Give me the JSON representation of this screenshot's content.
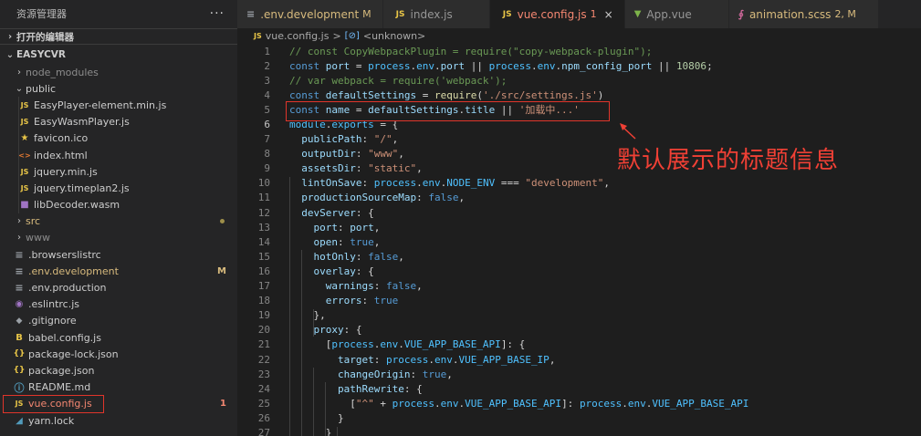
{
  "explorer": {
    "title": "资源管理器",
    "more": "···",
    "open_editors": "打开的编辑器",
    "project": "EASYCVR",
    "items": [
      {
        "label": "node_modules",
        "icon": "folder-collapsed",
        "badge": ""
      },
      {
        "label": "public",
        "icon": "folder-expanded",
        "badge": ""
      },
      {
        "label": "EasyPlayer-element.min.js",
        "icon": "js-file-icon",
        "iconText": "JS",
        "badge": ""
      },
      {
        "label": "EasyWasmPlayer.js",
        "icon": "js-file-icon",
        "iconText": "JS",
        "badge": ""
      },
      {
        "label": "favicon.ico",
        "icon": "favicon-icon",
        "iconText": "★",
        "badge": ""
      },
      {
        "label": "index.html",
        "icon": "html-file-icon",
        "iconText": "<>",
        "badge": ""
      },
      {
        "label": "jquery.min.js",
        "icon": "js-file-icon",
        "iconText": "JS",
        "badge": ""
      },
      {
        "label": "jquery.timeplan2.js",
        "icon": "js-file-icon",
        "iconText": "JS",
        "badge": ""
      },
      {
        "label": "libDecoder.wasm",
        "icon": "wasm-file-icon",
        "iconText": "■",
        "badge": ""
      },
      {
        "label": "src",
        "icon": "folder-collapsed",
        "badge": ""
      },
      {
        "label": "www",
        "icon": "folder-collapsed",
        "badge": ""
      },
      {
        "label": ".browserslistrc",
        "icon": "config-file-icon",
        "iconText": "≡",
        "badge": ""
      },
      {
        "label": ".env.development",
        "icon": "env-file-icon",
        "iconText": "≡",
        "badge": "M"
      },
      {
        "label": ".env.production",
        "icon": "env-file-icon",
        "iconText": "≡",
        "badge": ""
      },
      {
        "label": ".eslintrc.js",
        "icon": "eslint-icon",
        "iconText": "◉",
        "badge": ""
      },
      {
        "label": ".gitignore",
        "icon": "git-icon",
        "iconText": "◆",
        "badge": ""
      },
      {
        "label": "babel.config.js",
        "icon": "babel-icon",
        "iconText": "B",
        "badge": ""
      },
      {
        "label": "package-lock.json",
        "icon": "json-file-icon",
        "iconText": "{}",
        "badge": ""
      },
      {
        "label": "package.json",
        "icon": "json-file-icon",
        "iconText": "{}",
        "badge": ""
      },
      {
        "label": "README.md",
        "icon": "info-icon",
        "iconText": "ⓘ",
        "badge": ""
      },
      {
        "label": "vue.config.js",
        "icon": "js-file-icon",
        "iconText": "JS",
        "badge": "1"
      },
      {
        "label": "yarn.lock",
        "icon": "yarn-icon",
        "iconText": "◢",
        "badge": ""
      }
    ]
  },
  "tabs": [
    {
      "label": ".env.development",
      "icon": "env-file-icon",
      "iconText": "≡",
      "badge": "M"
    },
    {
      "label": "index.js",
      "icon": "js-file-icon",
      "iconText": "JS",
      "badge": ""
    },
    {
      "label": "vue.config.js",
      "icon": "js-file-icon",
      "iconText": "JS",
      "badge": "1",
      "close": "×"
    },
    {
      "label": "App.vue",
      "icon": "vue-icon",
      "iconText": "▼",
      "badge": ""
    },
    {
      "label": "animation.scss",
      "icon": "scss-icon",
      "iconText": "∮",
      "badge": "2, M"
    }
  ],
  "breadcrumb": {
    "file": "vue.config.js",
    "separator": ">",
    "symbol_icon": "[⊘]",
    "symbol": "<unknown>"
  },
  "code": {
    "lines": [
      {
        "n": "1",
        "t": "// const CopyWebpackPlugin = require(\"copy-webpack-plugin\");"
      },
      {
        "n": "2",
        "t": "const port = process.env.port || process.env.npm_config_port || 10806;"
      },
      {
        "n": "3",
        "t": "// var webpack = require('webpack');"
      },
      {
        "n": "4",
        "t": "const defaultSettings = require('./src/settings.js')"
      },
      {
        "n": "5",
        "t": "const name = defaultSettings.title || '加载中...'"
      },
      {
        "n": "6",
        "t": "module.exports = {"
      },
      {
        "n": "7",
        "t": "  publicPath: \"/\","
      },
      {
        "n": "8",
        "t": "  outputDir: \"www\","
      },
      {
        "n": "9",
        "t": "  assetsDir: \"static\","
      },
      {
        "n": "10",
        "t": "  lintOnSave: process.env.NODE_ENV === \"development\","
      },
      {
        "n": "11",
        "t": "  productionSourceMap: false,"
      },
      {
        "n": "12",
        "t": "  devServer: {"
      },
      {
        "n": "13",
        "t": "    port: port,"
      },
      {
        "n": "14",
        "t": "    open: true,"
      },
      {
        "n": "15",
        "t": "    hotOnly: false,"
      },
      {
        "n": "16",
        "t": "    overlay: {"
      },
      {
        "n": "17",
        "t": "      warnings: false,"
      },
      {
        "n": "18",
        "t": "      errors: true"
      },
      {
        "n": "19",
        "t": "    },"
      },
      {
        "n": "20",
        "t": "    proxy: {"
      },
      {
        "n": "21",
        "t": "      [process.env.VUE_APP_BASE_API]: {"
      },
      {
        "n": "22",
        "t": "        target: process.env.VUE_APP_BASE_IP,"
      },
      {
        "n": "23",
        "t": "        changeOrigin: true,"
      },
      {
        "n": "24",
        "t": "        pathRewrite: {"
      },
      {
        "n": "25",
        "t": "          [\"^\" + process.env.VUE_APP_BASE_API]: process.env.VUE_APP_BASE_API"
      },
      {
        "n": "26",
        "t": "        }"
      },
      {
        "n": "27",
        "t": "      }"
      }
    ]
  },
  "annotation": {
    "text": "默认展示的标题信息",
    "color": "#f04035"
  },
  "colors": {
    "sidebar_bg": "#252526",
    "editor_bg": "#1e1e1e",
    "modified": "#d7ba7d",
    "error": "#f48771",
    "highlight_box": "#e0352b"
  }
}
